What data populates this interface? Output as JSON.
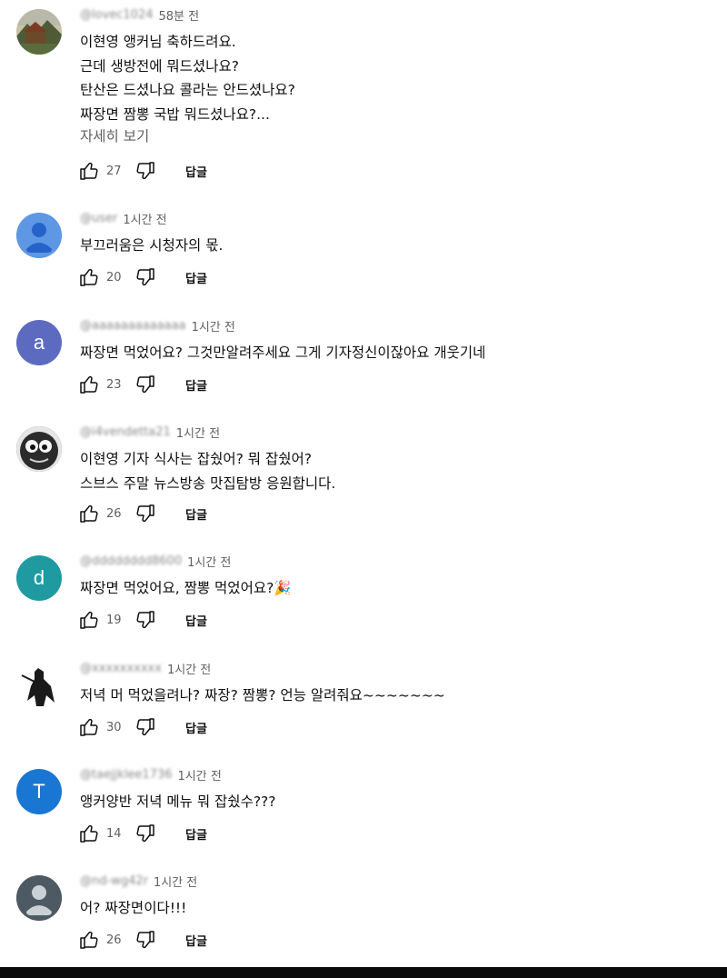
{
  "comments": [
    {
      "handle": "@lovec1024",
      "time": "58분 전",
      "avatar": {
        "type": "photo",
        "icon": "landscape-photo-avatar",
        "color": "#5f6d4c"
      },
      "lines": [
        "이현영 앵커님 축하드려요.",
        "근데 생방전에 뭐드셨나요?",
        "탄산은 드셨나요 콜라는 안드셨나요?",
        "짜장면 짬뽕 국밥 뭐드셨나요?..."
      ],
      "more": "자세히 보기",
      "likes": "27",
      "reply": "답글"
    },
    {
      "handle": "@user",
      "time": "1시간 전",
      "avatar": {
        "type": "default",
        "icon": "default-person-avatar",
        "color": "#5e97e4"
      },
      "lines": [
        "부끄러움은 시청자의 몫."
      ],
      "likes": "20",
      "reply": "답글"
    },
    {
      "handle": "@aaaaaaaaaaaaa",
      "time": "1시간 전",
      "avatar": {
        "type": "letter",
        "letter": "a",
        "color": "#5c6bc0"
      },
      "lines": [
        "짜장면 먹었어요? 그것만알려주세요 그게 기자정신이잖아요 개웃기네"
      ],
      "likes": "23",
      "reply": "답글"
    },
    {
      "handle": "@i4vendetta21",
      "time": "1시간 전",
      "avatar": {
        "type": "photo",
        "icon": "cartoon-face-avatar",
        "color": "#2b2b2b"
      },
      "lines": [
        "이현영 기자 식사는 잡쉈어? 뭐 잡쉈어?",
        "스브스 주말 뉴스방송 맛집탐방 응원합니다."
      ],
      "likes": "26",
      "reply": "답글"
    },
    {
      "handle": "@dddddddd8600",
      "time": "1시간 전",
      "avatar": {
        "type": "letter",
        "letter": "d",
        "color": "#1e9aa0"
      },
      "lines": [
        "짜장면 먹었어요, 짬뽕 먹었어요?🎉"
      ],
      "likes": "19",
      "reply": "답글"
    },
    {
      "handle": "@xxxxxxxxxx",
      "time": "1시간 전",
      "avatar": {
        "type": "photo",
        "icon": "dark-figure-avatar",
        "color": "#ffffff"
      },
      "lines": [
        "저녁 머 먹었을려나? 짜장? 짬뽕? 언능 알려줘요~~~~~~~"
      ],
      "likes": "30",
      "reply": "답글"
    },
    {
      "handle": "@taejjklee1736",
      "time": "1시간 전",
      "avatar": {
        "type": "letter",
        "letter": "T",
        "color": "#1976d2"
      },
      "lines": [
        "앵커양반 저녁 메뉴 뭐 잡쉈수???"
      ],
      "likes": "14",
      "reply": "답글"
    },
    {
      "handle": "@nd-wg42r",
      "time": "1시간 전",
      "avatar": {
        "type": "default",
        "icon": "default-person-avatar",
        "color": "#4d5a63"
      },
      "lines": [
        "어? 짜장면이다!!!"
      ],
      "likes": "26",
      "reply": "답글"
    }
  ]
}
